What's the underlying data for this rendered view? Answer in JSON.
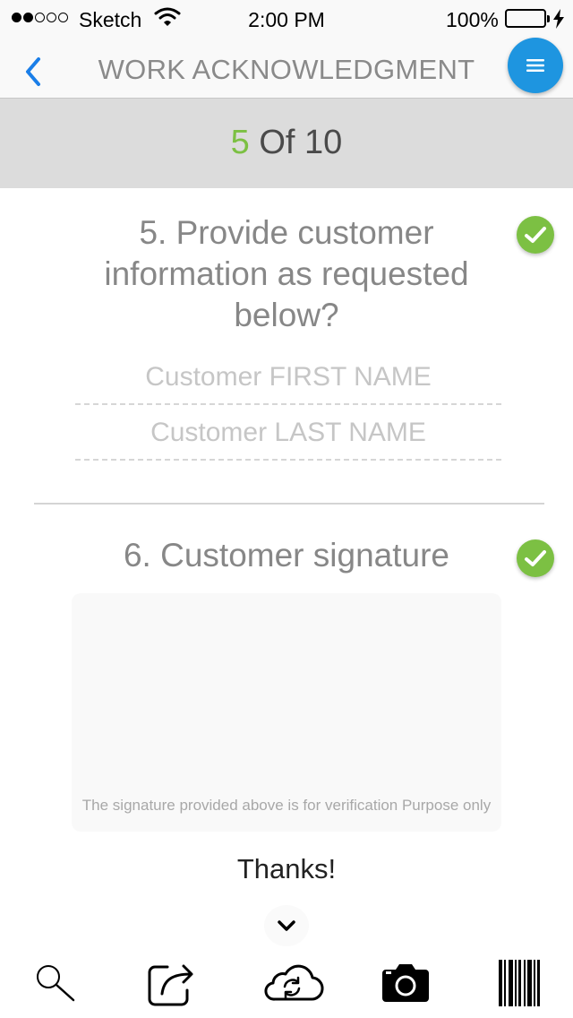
{
  "status_bar": {
    "carrier": "Sketch",
    "time": "2:00 PM",
    "battery": "100%",
    "signal_bars_filled": 2,
    "signal_bars_total": 5
  },
  "nav": {
    "title": "WORK ACKNOWLEDGMENT",
    "back_icon": "chevron-left-icon",
    "menu_icon": "hamburger-menu-icon"
  },
  "progress": {
    "current": "5",
    "separator": " Of ",
    "total": "10"
  },
  "questions": [
    {
      "title": "5. Provide customer information as requested below?",
      "completed": true,
      "fields": [
        {
          "placeholder": "Customer FIRST NAME",
          "value": ""
        },
        {
          "placeholder": "Customer LAST NAME",
          "value": ""
        }
      ]
    },
    {
      "title": "6. Customer signature",
      "completed": true,
      "signature_note": "The signature provided above is for verification Purpose only"
    }
  ],
  "thanks": "Thanks!",
  "toolbar": {
    "items": [
      "search-icon",
      "share-icon",
      "cloud-sync-icon",
      "camera-icon",
      "barcode-icon"
    ]
  },
  "colors": {
    "accent_blue": "#1e95e0",
    "ios_blue": "#1a7ee8",
    "success_green": "#7cc043",
    "battery_green": "#4cd964",
    "progress_band": "#dcdcdc",
    "title_gray": "#878787"
  }
}
